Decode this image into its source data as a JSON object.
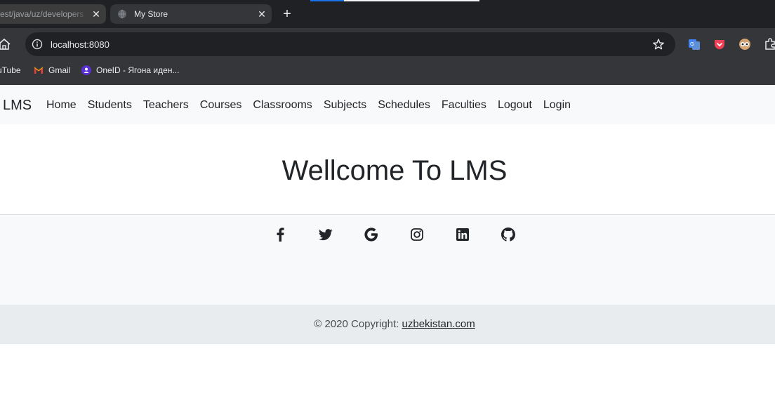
{
  "browser": {
    "tabs": [
      {
        "title": "est/java/uz/developers"
      },
      {
        "title": "My Store"
      }
    ],
    "new_tab_symbol": "+",
    "close_symbol": "✕",
    "address": "localhost:8080",
    "bookmarks": [
      {
        "label": "uTube"
      },
      {
        "label": "Gmail"
      },
      {
        "label": "OneID - Ягона иден..."
      }
    ]
  },
  "navbar": {
    "brand": "LMS",
    "links": [
      "Home",
      "Students",
      "Teachers",
      "Courses",
      "Classrooms",
      "Subjects",
      "Schedules",
      "Faculties",
      "Logout",
      "Login"
    ]
  },
  "hero": {
    "title": "Wellcome To LMS"
  },
  "footer": {
    "social_icons": [
      "facebook-icon",
      "twitter-icon",
      "google-icon",
      "instagram-icon",
      "linkedin-icon",
      "github-icon"
    ],
    "copyright_prefix": "© 2020 Copyright: ",
    "copyright_link": "uzbekistan.com"
  },
  "colors": {
    "browser_dark": "#202124",
    "toolbar": "#35363a",
    "navbar_bg": "#f8f9fa",
    "copyright_bg": "#e9ecef",
    "text": "#212529"
  }
}
